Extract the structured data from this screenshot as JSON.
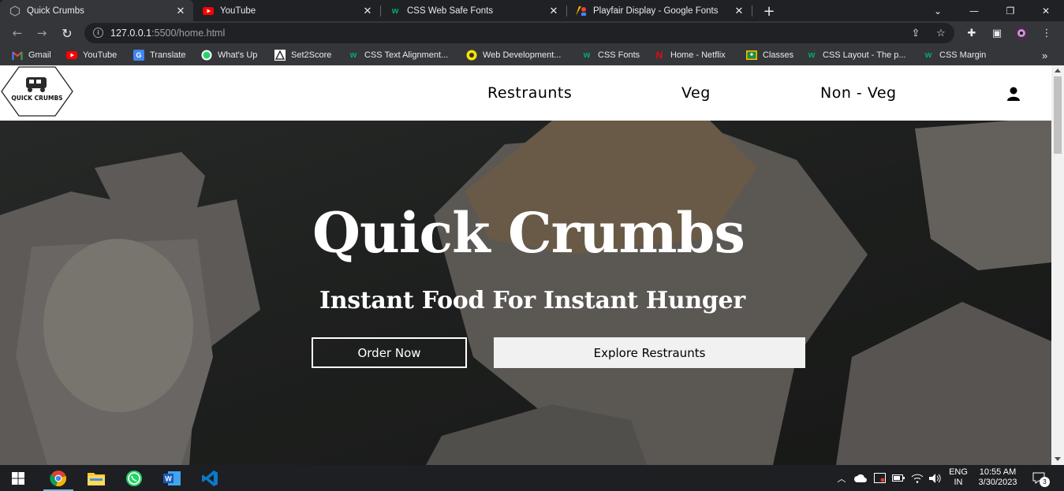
{
  "browser": {
    "tabs": [
      {
        "label": "Quick Crumbs",
        "active": true,
        "icon": "quick-crumbs-favicon"
      },
      {
        "label": "YouTube",
        "active": false,
        "icon": "youtube-icon"
      },
      {
        "label": "CSS Web Safe Fonts",
        "active": false,
        "icon": "w3schools-icon"
      },
      {
        "label": "Playfair Display - Google Fonts",
        "active": false,
        "icon": "google-fonts-icon"
      }
    ],
    "new_tab_glyph": "+",
    "url_host": "127.0.0.1",
    "url_rest": ":5500/home.html",
    "bookmarks": [
      {
        "label": "Gmail",
        "icon": "gmail-icon"
      },
      {
        "label": "YouTube",
        "icon": "youtube-icon"
      },
      {
        "label": "Translate",
        "icon": "translate-icon"
      },
      {
        "label": "What's Up",
        "icon": "whatsapp-icon"
      },
      {
        "label": "Set2Score",
        "icon": "set2score-icon"
      },
      {
        "label": "CSS Text Alignment...",
        "icon": "w3schools-icon"
      },
      {
        "label": "Web Development...",
        "icon": "web-dev-icon"
      },
      {
        "label": "CSS Fonts",
        "icon": "w3schools-icon"
      },
      {
        "label": "Home - Netflix",
        "icon": "netflix-icon"
      },
      {
        "label": "Classes",
        "icon": "classroom-icon"
      },
      {
        "label": "CSS Layout - The p...",
        "icon": "w3schools-icon"
      },
      {
        "label": "CSS Margin",
        "icon": "w3schools-icon"
      }
    ],
    "bookmarks_overflow": "»"
  },
  "site": {
    "logo_text": "QUICK CRUMBS",
    "nav": [
      "Restraunts",
      "Veg",
      "Non - Veg"
    ],
    "hero_title": "Quick Crumbs",
    "hero_subtitle": "Instant Food For Instant Hunger",
    "order_button": "Order Now",
    "explore_button": "Explore Restraunts"
  },
  "taskbar": {
    "apps": [
      "start-icon",
      "chrome-icon",
      "file-explorer-icon",
      "whatsapp-icon",
      "word-icon",
      "vscode-icon"
    ],
    "lang_line1": "ENG",
    "lang_line2": "IN",
    "time": "10:55 AM",
    "date": "3/30/2023",
    "notifications": "3"
  },
  "colors": {
    "chrome_dark": "#202124",
    "chrome_toolbar": "#35363a",
    "hero_bg": "#2f3130",
    "taskbar": "#1e1f22"
  }
}
